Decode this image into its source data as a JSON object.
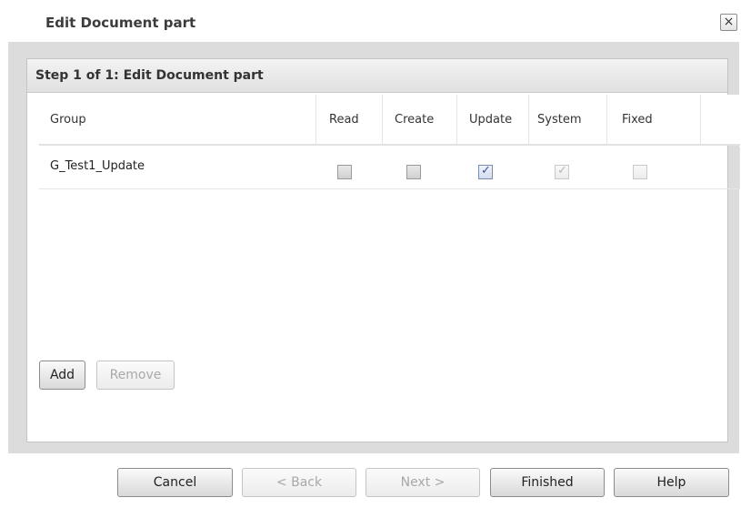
{
  "dialog": {
    "title": "Edit Document part",
    "close_label": "×"
  },
  "panel": {
    "step_title": "Step 1 of 1: Edit Document part"
  },
  "grid": {
    "columns": [
      "Group",
      "Read",
      "Create",
      "Update",
      "System",
      "Fixed"
    ],
    "rows": [
      {
        "group": "G_Test1_Update",
        "read": false,
        "create": false,
        "update": true,
        "system": true,
        "fixed": false
      }
    ]
  },
  "actions": {
    "add_label": "Add",
    "remove_label": "Remove"
  },
  "footer": {
    "cancel_label": "Cancel",
    "back_label": "< Back",
    "next_label": "Next >",
    "finished_label": "Finished",
    "help_label": "Help"
  }
}
